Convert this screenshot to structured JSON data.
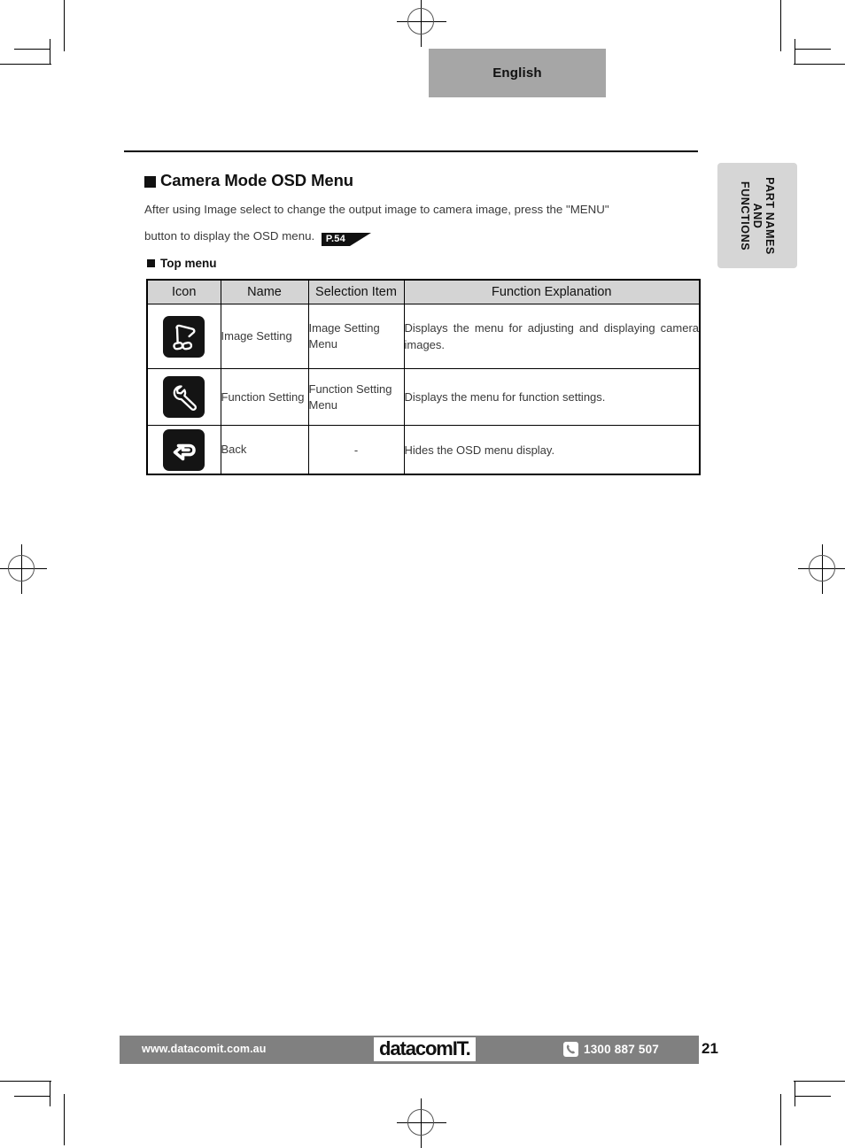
{
  "language_tab": {
    "label": "English"
  },
  "side_tab": {
    "label": "PART NAMES\nAND\nFUNCTIONS",
    "line1": "PART NAMES",
    "line2": "AND",
    "line3": "FUNCTIONS"
  },
  "section": {
    "heading": "Camera Mode OSD Menu",
    "body": "After using Image select to change the output image to camera image, press the \"MENU\"",
    "body_line2": "button to display the OSD menu.",
    "page_ref": "P.54",
    "subheading": "Top menu"
  },
  "table": {
    "headers": [
      "Icon",
      "Name",
      "Selection Item",
      "Function Explanation"
    ],
    "rows": [
      {
        "icon": "document-camera-icon",
        "name": "Image Setting",
        "selection_item": "Image Setting Menu",
        "explanation": "Displays the menu for adjusting and displaying camera images."
      },
      {
        "icon": "wrench-icon",
        "name": "Function Setting",
        "selection_item": "Function Setting Menu",
        "explanation": "Displays the menu for function settings."
      },
      {
        "icon": "back-arrow-icon",
        "name": "Back",
        "selection_item": "-",
        "explanation": "Hides the OSD menu display."
      }
    ]
  },
  "footer": {
    "url": "www.datacomit.com.au",
    "logo": "datacomIT.",
    "phone": "1300 887 507",
    "phone_icon": "phone-icon",
    "page_number": "21"
  },
  "colors": {
    "header_band": "#a6a6a6",
    "table_header": "#d4d4d4",
    "side_tab": "#d6d6d6",
    "footer_bar": "#808080",
    "icon_bg": "#141414"
  }
}
